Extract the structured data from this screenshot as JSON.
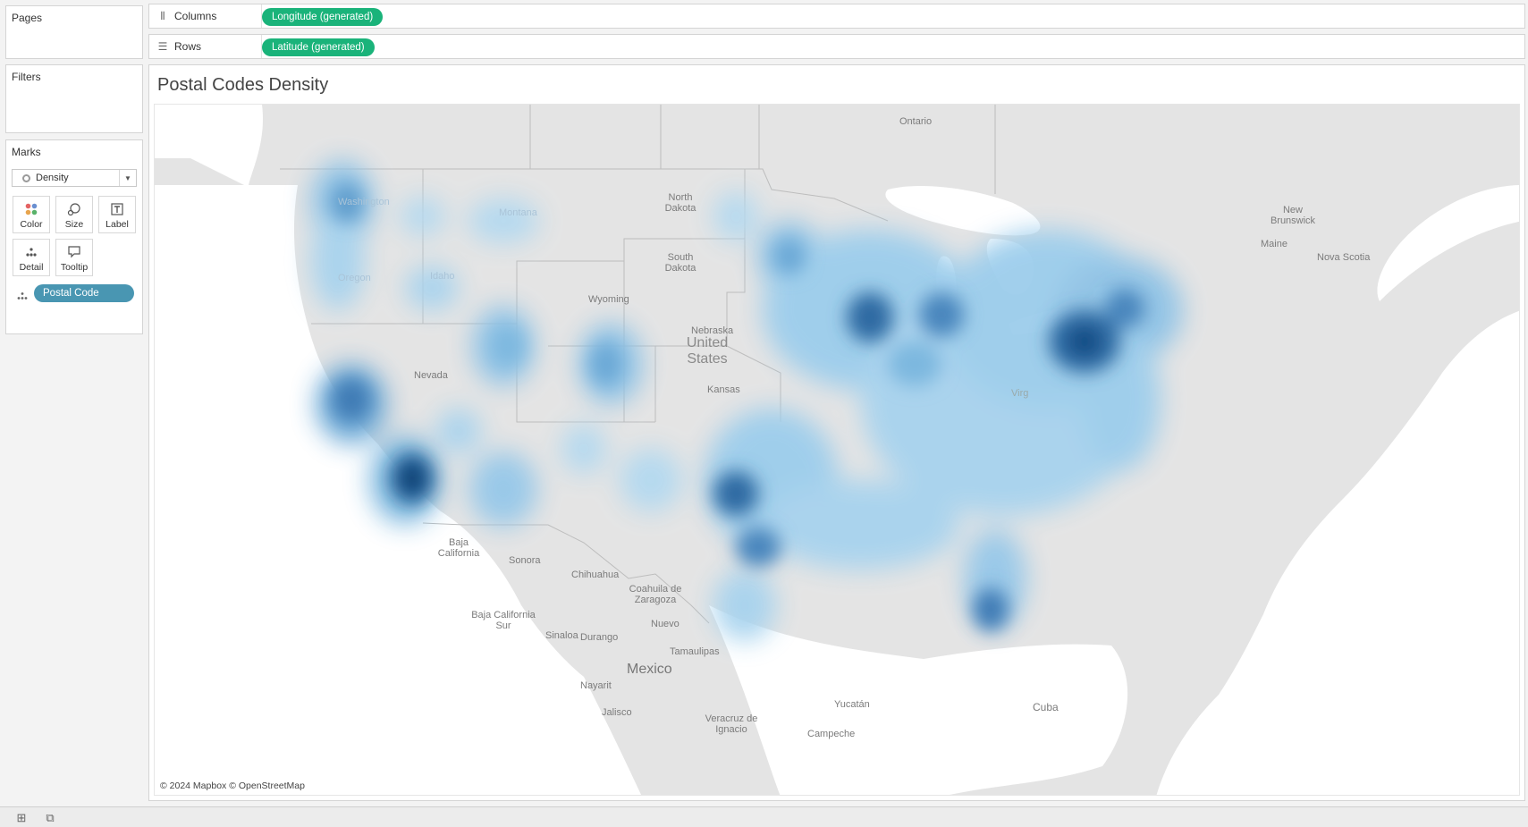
{
  "cards": {
    "pages": {
      "title": "Pages"
    },
    "filters": {
      "title": "Filters"
    },
    "marks": {
      "title": "Marks",
      "mark_type": "Density",
      "buttons": [
        {
          "label": "Color",
          "icon": "color-icon"
        },
        {
          "label": "Size",
          "icon": "size-icon"
        },
        {
          "label": "Label",
          "icon": "label-icon"
        },
        {
          "label": "Detail",
          "icon": "detail-icon"
        },
        {
          "label": "Tooltip",
          "icon": "tooltip-icon"
        }
      ],
      "detail_field": "Postal Code"
    }
  },
  "shelves": {
    "columns": {
      "label": "Columns",
      "pill": "Longitude (generated)"
    },
    "rows": {
      "label": "Rows",
      "pill": "Latitude (generated)"
    }
  },
  "view": {
    "title": "Postal Codes Density",
    "attribution": "© 2024 Mapbox © OpenStreetMap",
    "map_labels": {
      "ontario": "Ontario",
      "north_dakota": "North Dakota",
      "south_dakota": "South Dakota",
      "montana": "Montana",
      "idaho": "Idaho",
      "oregon": "Oregon",
      "washington": "Washington",
      "wyoming": "Wyoming",
      "nebraska": "Nebraska",
      "nevada": "Nevada",
      "kansas": "Kansas",
      "united_states": "United States",
      "new_brunswick": "New Brunswick",
      "nova_scotia": "Nova Scotia",
      "maine": "Maine",
      "baja_california": "Baja California",
      "sonora": "Sonora",
      "chihuahua": "Chihuahua",
      "coahuila": "Coahuila de Zaragoza",
      "baja_california_sur": "Baja California Sur",
      "sinaloa": "Sinaloa",
      "durango": "Durango",
      "nuevo": "Nuevo",
      "tamaulipas": "Tamaulipas",
      "mexico": "Mexico",
      "nayarit": "Nayarit",
      "jalisco": "Jalisco",
      "veracruz": "Veracruz de Ignacio",
      "yucatan": "Yucatán",
      "campeche": "Campeche",
      "cuba": "Cuba",
      "virginia": "Virg"
    }
  },
  "colors": {
    "pill_green": "#1ab37a",
    "pill_blue": "#4996b2",
    "density_dark": "#0b3e6e",
    "density_light": "#a7d3ee",
    "land": "#e4e4e4",
    "water": "#ffffff"
  }
}
